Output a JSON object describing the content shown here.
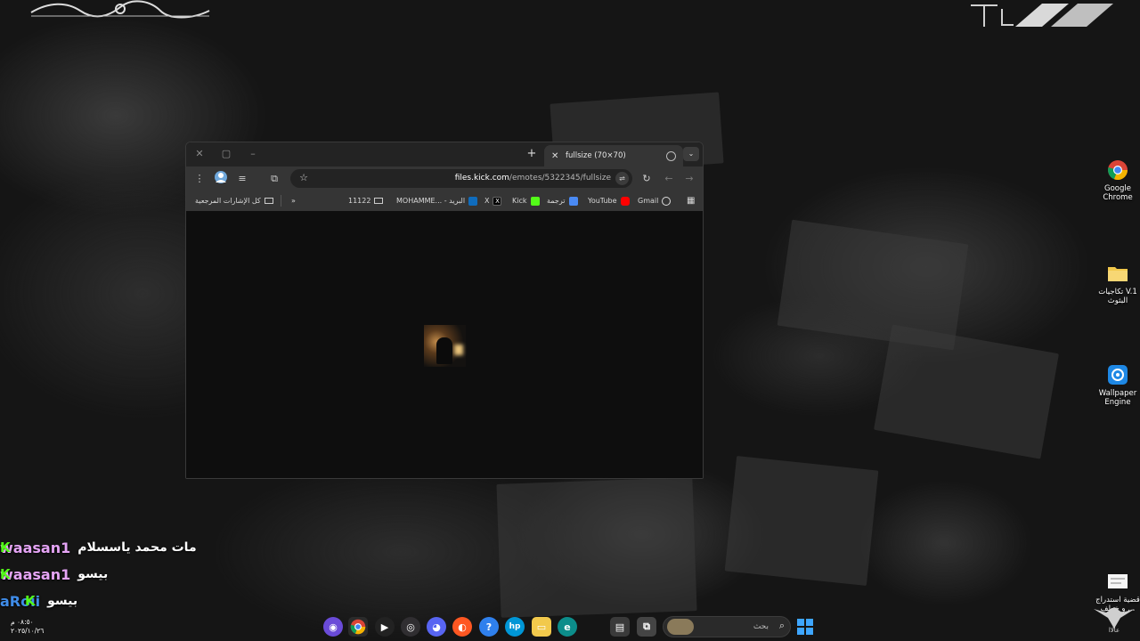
{
  "desktop": {
    "icons": [
      {
        "label": "Google Chrome",
        "icon": "chrome-icon"
      },
      {
        "label": "تكاجيات V.1 البثوث",
        "icon": "folder-icon"
      },
      {
        "label": "Wallpaper Engine",
        "icon": "wallpaper-engine-icon"
      },
      {
        "label": "قضية استدراج ... و خطف",
        "icon": "document-icon"
      }
    ],
    "corner_caption": "عالاا"
  },
  "browser": {
    "tab_title": "fullsize (70×70)",
    "new_tab": "+",
    "url_host": "files.kick.com",
    "url_path": "/emotes/5322345/fullsize",
    "bookmarks": [
      {
        "label": "Gmail",
        "color": "#ffffff"
      },
      {
        "label": "YouTube",
        "color": "#ff0000"
      },
      {
        "label": "ترجمة",
        "color": "#4a8af4"
      },
      {
        "label": "Kick",
        "color": "#53fc18"
      },
      {
        "label": "X",
        "color": "#000000"
      },
      {
        "label": "البريد - ...MOHAMME",
        "color": "#0f6cbd"
      },
      {
        "label": "11122",
        "color": "#888888"
      }
    ],
    "all_bookmarks": "كل الإشارات المرجعية",
    "overflow": "»"
  },
  "chat": [
    {
      "user": "waasan1",
      "message": "مات محمد ياسسلام",
      "user_color": "#e5a4f5"
    },
    {
      "user": "waasan1",
      "message": "بيسو",
      "user_color": "#e5a4f5"
    },
    {
      "user": "aRoii",
      "message": "بيسو",
      "user_color": "#3f8ce8"
    }
  ],
  "taskbar": {
    "search_placeholder": "بحث",
    "time": "٠٨:٥٠ م",
    "date": "٢٠٢٥/١٠/٢٦"
  }
}
